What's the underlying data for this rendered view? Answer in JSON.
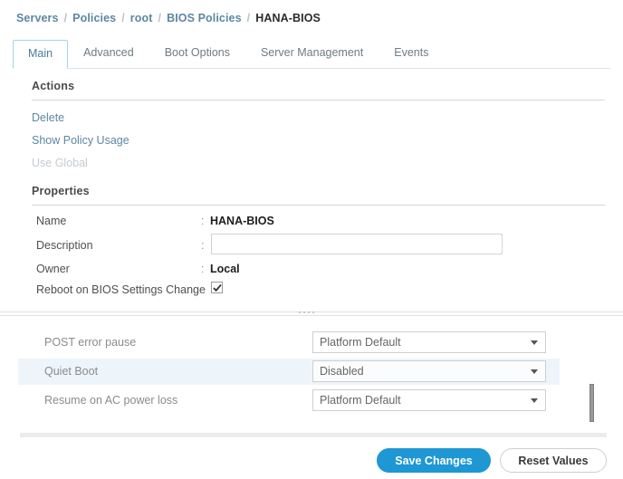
{
  "breadcrumb": {
    "separator": "/",
    "items": [
      {
        "label": "Servers",
        "current": false
      },
      {
        "label": "Policies",
        "current": false
      },
      {
        "label": "root",
        "current": false
      },
      {
        "label": "BIOS Policies",
        "current": false
      },
      {
        "label": "HANA-BIOS",
        "current": true
      }
    ]
  },
  "tabs": [
    {
      "label": "Main",
      "active": true
    },
    {
      "label": "Advanced",
      "active": false
    },
    {
      "label": "Boot Options",
      "active": false
    },
    {
      "label": "Server Management",
      "active": false
    },
    {
      "label": "Events",
      "active": false
    }
  ],
  "actions": {
    "title": "Actions",
    "items": [
      {
        "label": "Delete",
        "disabled": false
      },
      {
        "label": "Show Policy Usage",
        "disabled": false
      },
      {
        "label": "Use Global",
        "disabled": true
      }
    ]
  },
  "properties": {
    "title": "Properties",
    "colon": ":",
    "name": {
      "label": "Name",
      "value": "HANA-BIOS"
    },
    "description": {
      "label": "Description",
      "value": "",
      "placeholder": ""
    },
    "owner": {
      "label": "Owner",
      "value": "Local"
    },
    "reboot": {
      "label": "Reboot on BIOS Settings Change",
      "checked": true
    }
  },
  "settings": [
    {
      "label": "POST error pause",
      "value": "Platform Default",
      "selected": false
    },
    {
      "label": "Quiet Boot",
      "value": "Disabled",
      "selected": true
    },
    {
      "label": "Resume on AC power loss",
      "value": "Platform Default",
      "selected": false
    }
  ],
  "footer": {
    "save_label": "Save Changes",
    "reset_label": "Reset Values"
  },
  "colors": {
    "accent": "#1e97d4",
    "link": "#5d87a1",
    "selected_row": "#edf5fb",
    "tab_active_border": "#a8d4ea"
  }
}
